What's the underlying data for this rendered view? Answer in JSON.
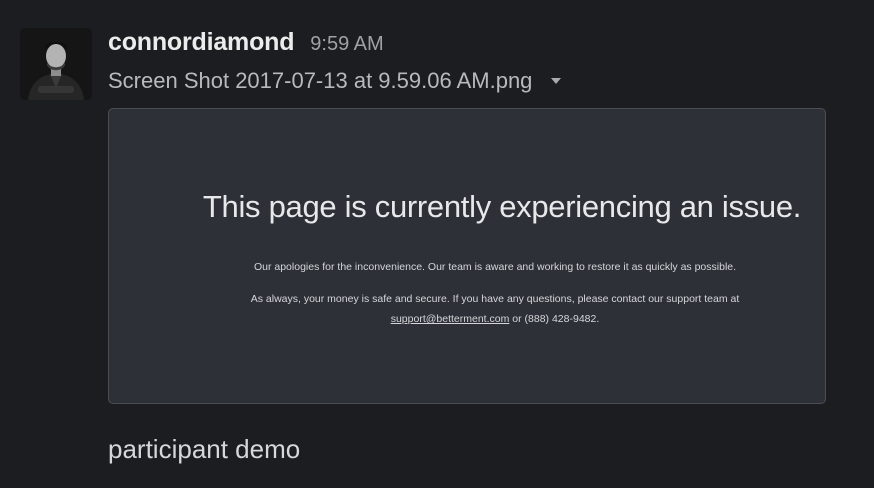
{
  "message": {
    "username": "connordiamond",
    "timestamp": "9:59 AM",
    "file": {
      "name": "Screen Shot 2017-07-13 at 9.59.06 AM.png",
      "menu_icon": "caret-down-icon"
    },
    "preview": {
      "title": "This page is currently experiencing an issue.",
      "line1": "Our apologies for the inconvenience. Our team is aware and working to restore it as quickly as possible.",
      "line2": "As always, your money is safe and secure. If you have any questions, please contact our support team at",
      "support_email": "support@betterment.com",
      "line3_suffix": " or (888) 428-9482."
    },
    "text": "participant demo"
  },
  "colors": {
    "background": "#1b1d21",
    "username": "#ececec",
    "timestamp": "#9fa1a6",
    "preview_bg": "#2d3137",
    "preview_border": "#4a4d53"
  }
}
